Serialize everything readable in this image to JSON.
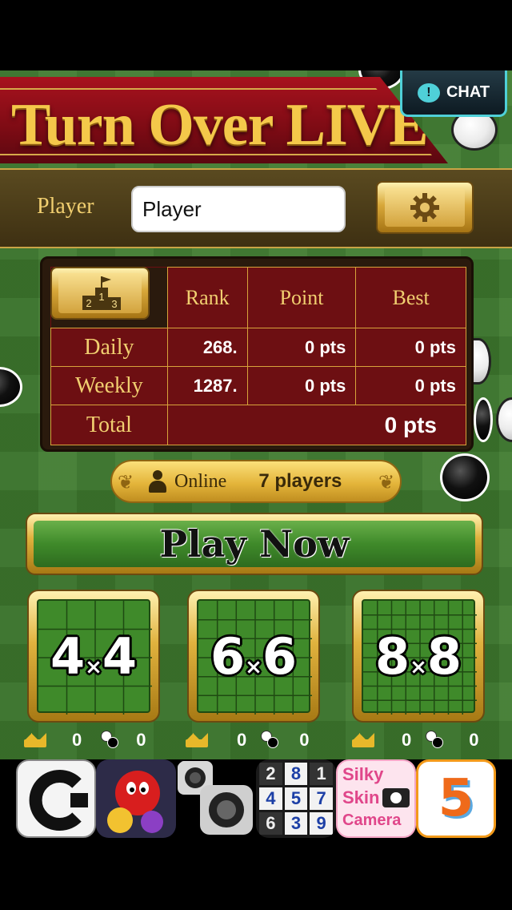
{
  "header": {
    "title": "Turn Over LIVE",
    "chat_label": "CHAT"
  },
  "player": {
    "label": "Player",
    "name_value": "Player"
  },
  "ranking": {
    "columns": [
      "Rank",
      "Point",
      "Best"
    ],
    "rows": [
      {
        "label": "Daily",
        "rank": "268.",
        "point": "0 pts",
        "best": "0 pts"
      },
      {
        "label": "Weekly",
        "rank": "1287.",
        "point": "0 pts",
        "best": "0 pts"
      }
    ],
    "total_label": "Total",
    "total_value": "0 pts",
    "podium_numbers": [
      "2",
      "1",
      "3"
    ]
  },
  "online": {
    "label": "Online",
    "count": "7 players"
  },
  "play_now_label": "Play Now",
  "boards": [
    {
      "a": "4",
      "b": "4",
      "wins": "0",
      "games": "0"
    },
    {
      "a": "6",
      "b": "6",
      "wins": "0",
      "games": "0"
    },
    {
      "a": "8",
      "b": "8",
      "wins": "0",
      "games": "0"
    }
  ],
  "board_multiply_sign": "×",
  "ads": [
    {
      "icon": "c-letter-icon"
    },
    {
      "icon": "red-monster-game-icon"
    },
    {
      "icon": "camera-app-icon"
    },
    {
      "icon": "number-puzzle-icon",
      "digits": [
        "2",
        "8",
        "1",
        "4",
        "5",
        "7",
        "6",
        "3",
        "9"
      ]
    },
    {
      "icon": "silky-skin-camera-icon",
      "text_lines": [
        "Silky",
        "Skin",
        "Camera"
      ]
    },
    {
      "icon": "five-kana-app-icon",
      "glyph": "5"
    }
  ],
  "colors": {
    "felt_green": "#3e7a2e",
    "banner_red": "#8b0d18",
    "gold": "#e0b23e",
    "table_red": "#6d0f12",
    "chat_cyan": "#4fd0d8"
  }
}
